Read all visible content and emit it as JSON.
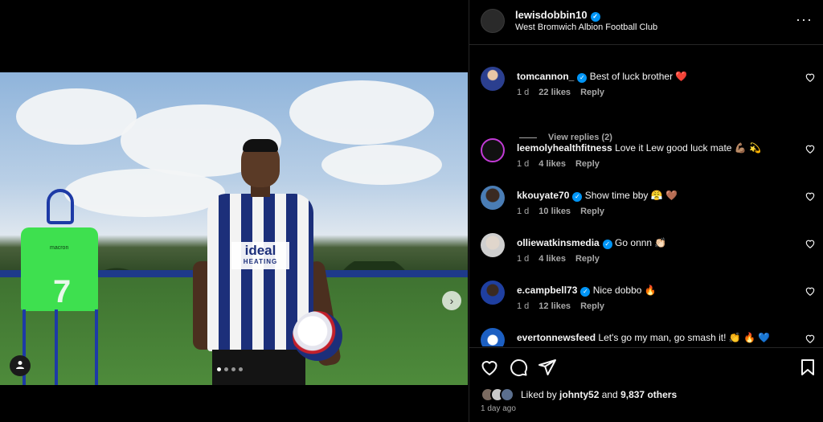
{
  "post": {
    "username": "lewisdobbin10",
    "location": "West Bromwich Albion Football Club",
    "more_icon": "more-horizontal-icon"
  },
  "media": {
    "sponsor_top": "ideal",
    "sponsor_bottom": "HEATING",
    "bib_number": "7",
    "bib_brand": "macron",
    "slide_count": 4,
    "active_slide": 1,
    "next_icon": "chevron-right-icon",
    "tag_icon": "user-tag-icon"
  },
  "comments": [
    {
      "username": "tomcannon_",
      "verified": true,
      "text": "Best of luck brother ❤️",
      "time": "1 d",
      "likes": "22 likes",
      "reply": "Reply",
      "view_replies": "View replies (2)"
    },
    {
      "username": "leemolyhealthfitness",
      "verified": false,
      "text": "Love it Lew good luck mate 💪🏽 💫",
      "time": "1 d",
      "likes": "4 likes",
      "reply": "Reply"
    },
    {
      "username": "kkouyate70",
      "verified": true,
      "text": "Show time bby 😤 🤎",
      "time": "1 d",
      "likes": "10 likes",
      "reply": "Reply"
    },
    {
      "username": "olliewatkinsmedia",
      "verified": true,
      "text": "Go onnn 👏🏻",
      "time": "1 d",
      "likes": "4 likes",
      "reply": "Reply"
    },
    {
      "username": "e.campbell73",
      "verified": true,
      "text": "Nice dobbo 🔥",
      "time": "1 d",
      "likes": "12 likes",
      "reply": "Reply"
    },
    {
      "username": "evertonnewsfeed",
      "verified": false,
      "text": "Let's go my man, go smash it! 👏 🔥 💙",
      "time": "",
      "likes": "",
      "reply": ""
    }
  ],
  "actions": {
    "like_icon": "heart-icon",
    "comment_icon": "comment-icon",
    "share_icon": "send-icon",
    "save_icon": "bookmark-icon"
  },
  "likes_summary": {
    "prefix": "Liked by ",
    "user": "johnty52",
    "middle": " and ",
    "others": "9,837 others"
  },
  "posted": "1 day ago",
  "colors": {
    "background": "#000000",
    "text": "#f5f5f5",
    "secondary": "#a8a8a8",
    "verified": "#0095f6",
    "divider": "#262626"
  }
}
